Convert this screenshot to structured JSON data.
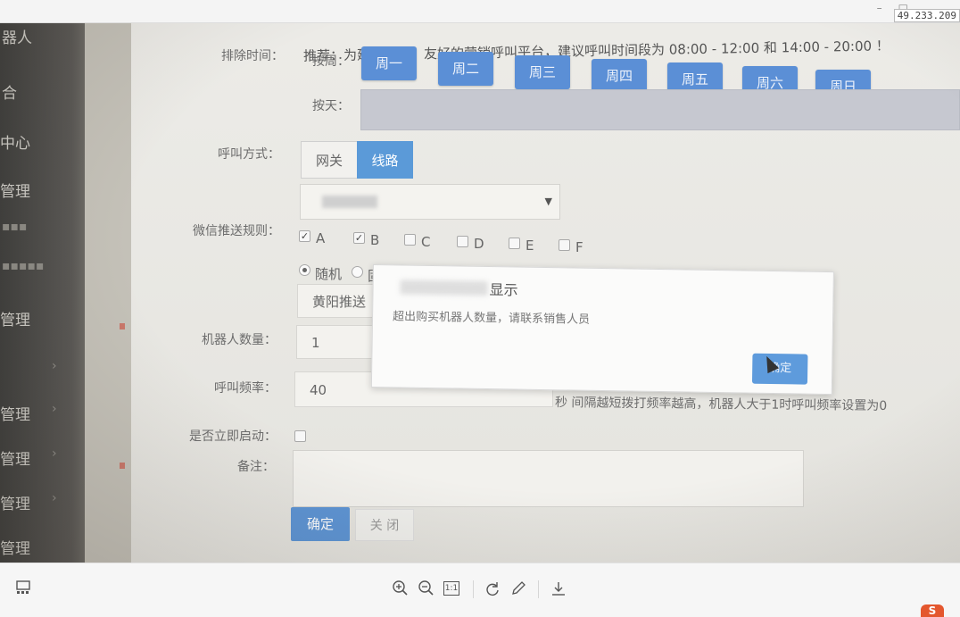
{
  "viewer": {
    "ip_label": "49.233.209",
    "minimize": "–",
    "maximize": "□"
  },
  "sidebar": {
    "items": [
      {
        "label": "器人"
      },
      {
        "label": "合"
      },
      {
        "label": "中心"
      },
      {
        "label": "管理"
      },
      {
        "label": "管理"
      },
      {
        "label": "管理"
      },
      {
        "label": "管理"
      },
      {
        "label": "管理"
      },
      {
        "label": "管理"
      }
    ]
  },
  "form": {
    "notice": "推荐：为建立健康、友好的营销呼叫平台，建议呼叫时间段为 08:00 - 12:00 和 14:00 - 20:00 ！",
    "exclude_time_label": "排除时间：",
    "by_week_label": "按周：",
    "weekdays": [
      "周一",
      "周二",
      "周三",
      "周四",
      "周五",
      "周六",
      "周日"
    ],
    "by_day_label": "按天：",
    "call_method_label": "呼叫方式：",
    "call_methods": [
      "网关",
      "线路"
    ],
    "wechat_rule_label": "微信推送规则：",
    "rule_options": [
      "A",
      "B",
      "C",
      "D",
      "E",
      "F"
    ],
    "push_modes": [
      "随机",
      "固"
    ],
    "push_target": "黄阳推送",
    "robot_count_label": "机器人数量：",
    "robot_count": "1",
    "call_freq_label": "呼叫频率：",
    "call_freq": "40",
    "freq_hint": "秒 间隔越短拨打频率越高，机器人大于1时呼叫频率设置为0",
    "auto_start_label": "是否立即启动：",
    "remark_label": "备注：",
    "confirm": "确定",
    "close": "关 闭"
  },
  "dialog": {
    "title": "显示",
    "message": "超出购买机器人数量，请联系销售人员",
    "ok": "确定"
  },
  "toolbar": {
    "icons": [
      "thumbnail-icon",
      "zoom-in-icon",
      "zoom-out-icon",
      "actual-size-icon",
      "rotate-icon",
      "edit-icon",
      "download-icon"
    ],
    "actual_size": "1:1",
    "brand": "S"
  }
}
